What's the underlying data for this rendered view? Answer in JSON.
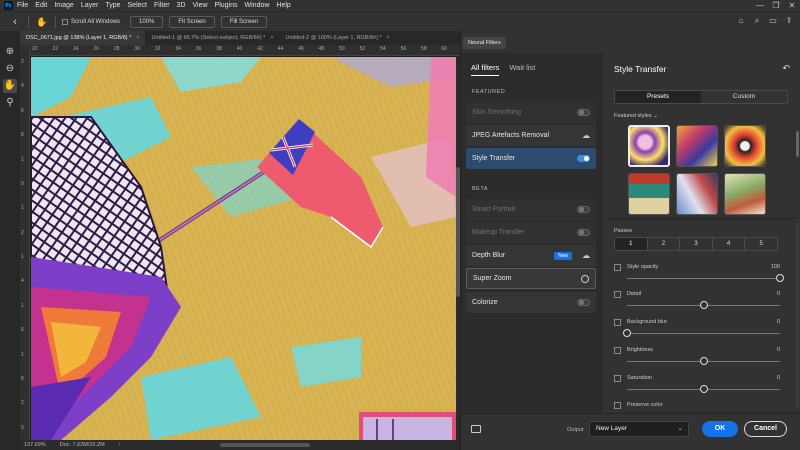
{
  "menubar": {
    "logo": "Ps",
    "items": [
      "File",
      "Edit",
      "Image",
      "Layer",
      "Type",
      "Select",
      "Filter",
      "3D",
      "View",
      "Plugins",
      "Window",
      "Help"
    ]
  },
  "options": {
    "scroll_all_windows": "Scroll All Windows",
    "zoom_100": "100%",
    "fit_screen": "Fit Screen",
    "fill_screen": "Fill Screen"
  },
  "tabs": [
    {
      "label": "DSC_0671.jpg @ 138% (Layer 1, RGB/8) *",
      "active": true
    },
    {
      "label": "Untitled-1 @ 66.7% (Select-subject, RGB/8#) *",
      "active": false
    },
    {
      "label": "Untitled-2 @ 100% (Layer 1, RGB/8#) *",
      "active": false
    }
  ],
  "ruler": {
    "top": [
      "20",
      "22",
      "24",
      "26",
      "28",
      "30",
      "32",
      "34",
      "36",
      "38",
      "40",
      "42",
      "44",
      "46",
      "48",
      "50",
      "52",
      "54",
      "56",
      "58",
      "60"
    ],
    "left": [
      "2",
      "4",
      "6",
      "8",
      "1",
      "0",
      "1",
      "2",
      "1",
      "4",
      "1",
      "6",
      "1",
      "8",
      "2",
      "0"
    ]
  },
  "status": {
    "zoom": "137.69%",
    "doc": "Doc: 7.62M/15.2M"
  },
  "neural_filters": {
    "panel_tab": "Neural Filters",
    "tabs": [
      "All filters",
      "Wait list"
    ],
    "featured_label": "FEATURED",
    "beta_label": "BETA",
    "featured": [
      {
        "name": "Skin Smoothing",
        "control": "toggle-off",
        "state": "dim"
      },
      {
        "name": "JPEG Artefacts Removal",
        "control": "cloud",
        "state": "normal"
      },
      {
        "name": "Style Transfer",
        "control": "toggle-on",
        "state": "selected"
      }
    ],
    "beta": [
      {
        "name": "Smart Portrait",
        "control": "toggle-off",
        "state": "dim"
      },
      {
        "name": "Makeup Transfer",
        "control": "toggle-off",
        "state": "dim"
      },
      {
        "name": "Depth Blur",
        "control": "cloud",
        "state": "normal",
        "badge": "New"
      },
      {
        "name": "Super Zoom",
        "control": "circle",
        "state": "outlined"
      },
      {
        "name": "Colorize",
        "control": "toggle-off",
        "state": "normal"
      }
    ]
  },
  "style_transfer": {
    "title": "Style Transfer",
    "seg": [
      "Presets",
      "Custom"
    ],
    "featured_styles": "Featured styles",
    "passes_label": "Passes",
    "passes": [
      "1",
      "2",
      "3",
      "4",
      "5"
    ],
    "sliders": [
      {
        "label": "Style opacity",
        "value": "100",
        "pos": 1.0
      },
      {
        "label": "Detail",
        "value": "0",
        "pos": 0.5
      },
      {
        "label": "Background blur",
        "value": "0",
        "pos": 0.0
      },
      {
        "label": "Brightness",
        "value": "0",
        "pos": 0.5
      },
      {
        "label": "Saturation",
        "value": "0",
        "pos": 0.5
      }
    ],
    "preserve_color": "Preserve color"
  },
  "footer": {
    "output_label": "Output",
    "output_value": "New Layer",
    "ok": "OK",
    "cancel": "Cancel"
  },
  "colors": {
    "accent": "#1473e6",
    "toggle_on": "#378ef0",
    "selected_row": "#2d4b6e"
  }
}
